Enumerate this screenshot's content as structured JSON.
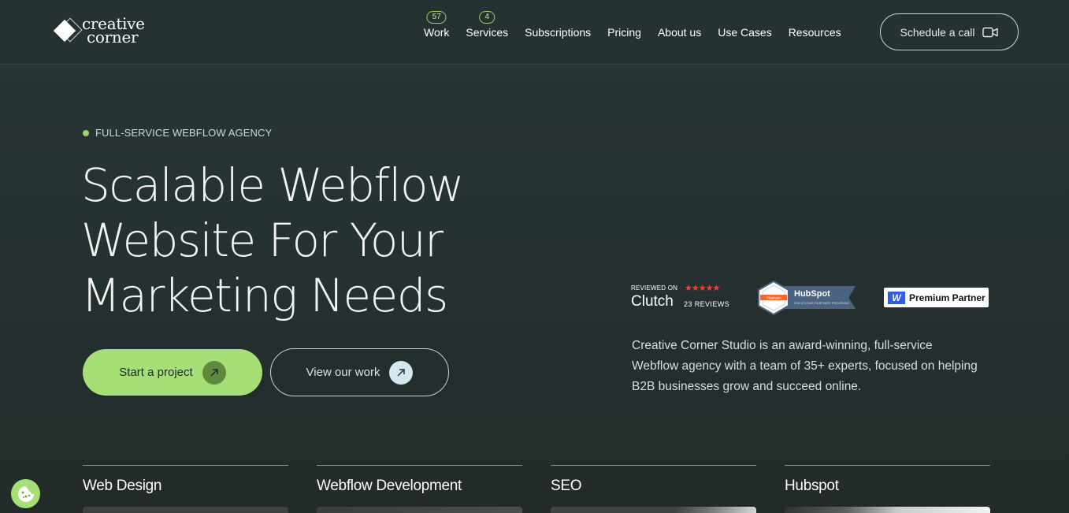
{
  "header": {
    "logo_line1": "creative",
    "logo_line2": "corner",
    "nav": [
      {
        "label": "Work",
        "badge": "57"
      },
      {
        "label": "Services",
        "badge": "4"
      },
      {
        "label": "Subscriptions"
      },
      {
        "label": "Pricing"
      },
      {
        "label": "About us"
      },
      {
        "label": "Use Cases"
      },
      {
        "label": "Resources"
      }
    ],
    "cta_label": "Schedule a call",
    "cta_icon": "video-camera-icon"
  },
  "hero": {
    "eyebrow": "FULL-SERVICE WEBFLOW AGENCY",
    "title_lines": [
      "Scalable Webflow",
      "Website For Your",
      "Marketing Needs"
    ],
    "primary_cta": "Start a project",
    "secondary_cta": "View our work",
    "description": "Creative Corner Studio is an award-winning, full-service Webflow agency with a team of 35+ experts, focused on helping B2B businesses grow and succeed online."
  },
  "badges": {
    "clutch": {
      "reviewed_on": "REVIEWED ON",
      "brand": "Clutch",
      "stars": "★★★★★",
      "reviews": "23 REVIEWS"
    },
    "hubspot": {
      "tier": "Platinum",
      "brand": "HubSpot",
      "program": "SOLUTIONS PARTNER PROGRAM"
    },
    "webflow": {
      "mark": "W",
      "label": "Premium Partner"
    }
  },
  "services": [
    "Web Design",
    "Webflow Development",
    "SEO",
    "Hubspot"
  ],
  "colors": {
    "background": "#263131",
    "accent_green": "#a6df75",
    "text": "#f2f4f3",
    "star_red": "#ef4335",
    "webflow_blue": "#2c5fe6"
  }
}
